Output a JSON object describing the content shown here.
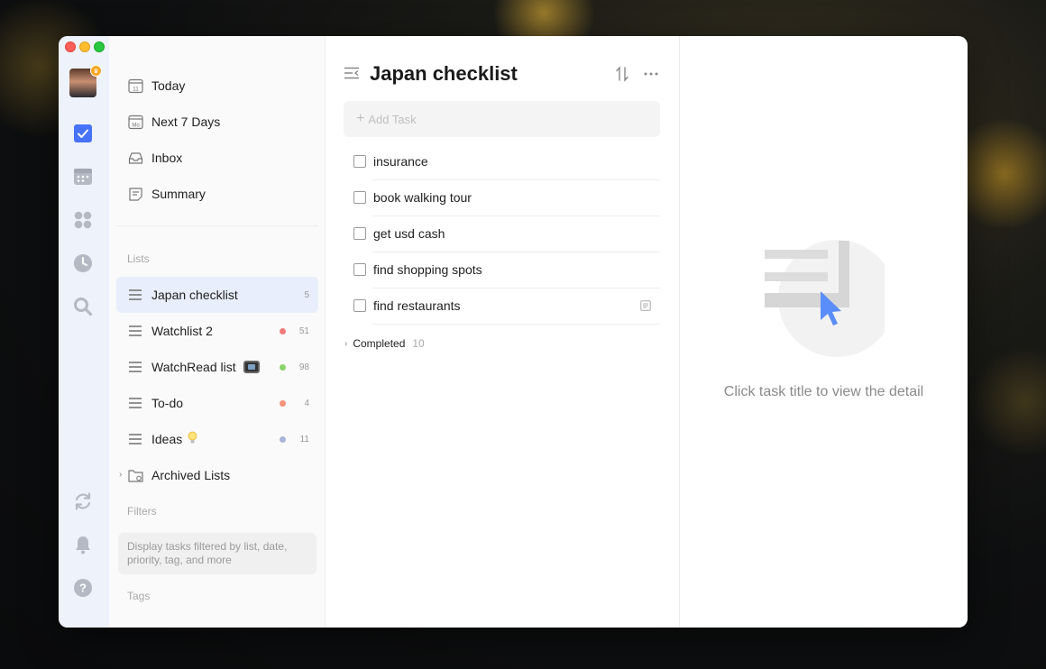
{
  "sidebar": {
    "nav": [
      {
        "label": "Today",
        "icon": "calendar-today-icon"
      },
      {
        "label": "Next 7 Days",
        "icon": "calendar-week-icon"
      },
      {
        "label": "Inbox",
        "icon": "inbox-icon"
      },
      {
        "label": "Summary",
        "icon": "summary-icon"
      }
    ],
    "today_icon_number": "11",
    "week_icon_text": "Mo",
    "lists_label": "Lists",
    "lists": [
      {
        "label": "Japan checklist",
        "count": "5",
        "dot": ""
      },
      {
        "label": "Watchlist 2",
        "count": "51",
        "dot": "#f07a7a"
      },
      {
        "label": "WatchRead list",
        "count": "98",
        "dot": "#8bd36a"
      },
      {
        "label": "To-do",
        "count": "4",
        "dot": "#f4927a"
      },
      {
        "label": "Ideas",
        "count": "11",
        "dot": "#a8b4d8"
      }
    ],
    "archived_label": "Archived Lists",
    "filters_label": "Filters",
    "filters_hint": "Display tasks filtered by list, date, priority, tag, and more",
    "tags_label": "Tags"
  },
  "main": {
    "title": "Japan checklist",
    "add_task_placeholder": "Add Task",
    "tasks": [
      {
        "label": "insurance"
      },
      {
        "label": "book walking tour"
      },
      {
        "label": "get usd cash"
      },
      {
        "label": "find shopping spots"
      },
      {
        "label": "find restaurants",
        "has_note": true
      }
    ],
    "completed_label": "Completed",
    "completed_count": "10"
  },
  "detail": {
    "empty_text": "Click task title to view the detail"
  },
  "colors": {
    "accent": "#4772fa",
    "active_bg": "#e8eefb"
  }
}
